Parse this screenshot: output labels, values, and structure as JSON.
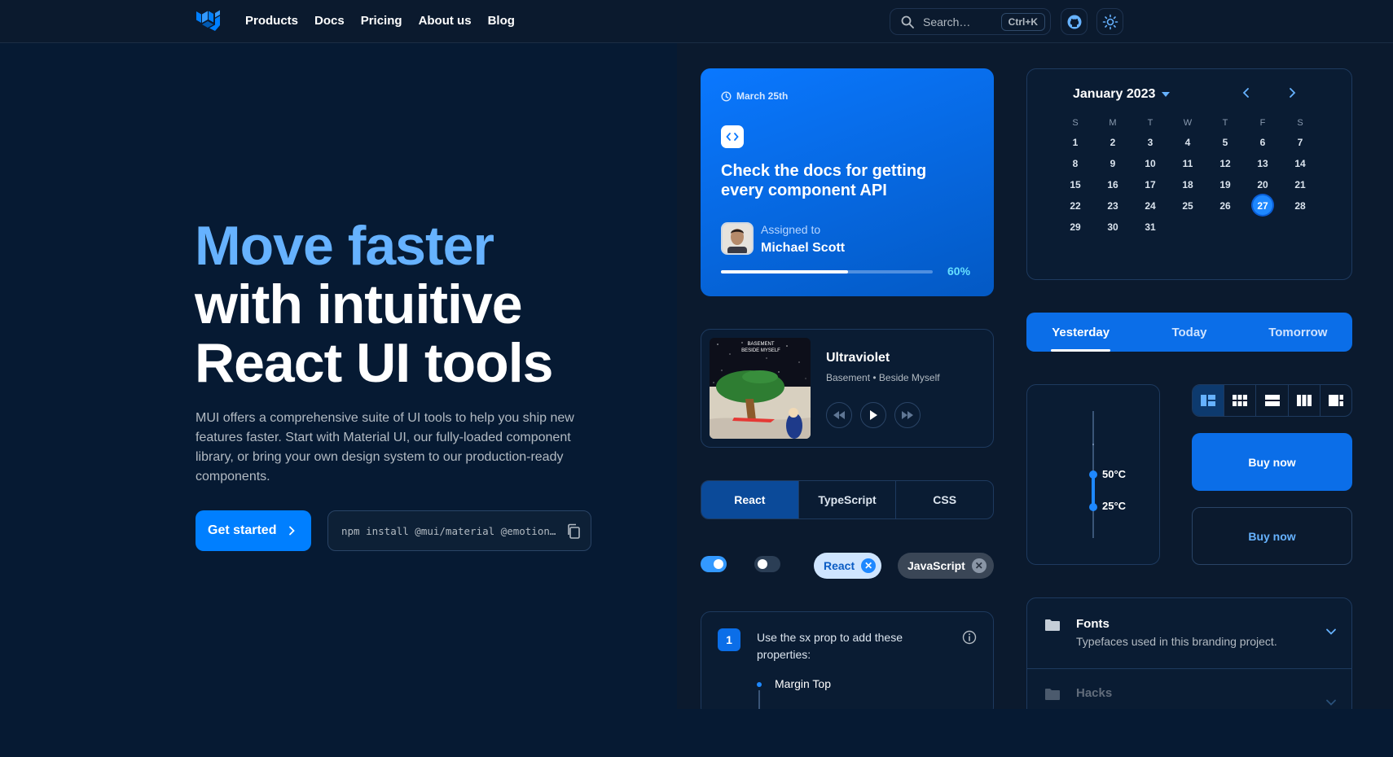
{
  "header": {
    "nav": [
      "Products",
      "Docs",
      "Pricing",
      "About us",
      "Blog"
    ],
    "search_placeholder": "Search…",
    "search_shortcut": "Ctrl+K"
  },
  "hero": {
    "title_accent": "Move faster",
    "title_line2": "with intuitive",
    "title_line3": "React UI tools",
    "description": "MUI offers a comprehensive suite of UI tools to help you ship new features faster. Start with Material UI, our fully-loaded component library, or bring your own design system to our production-ready components.",
    "cta_label": "Get started",
    "install_cmd": "npm install @mui/material @emotion…"
  },
  "task_card": {
    "date": "March 25th",
    "title": "Check the docs for getting every component API",
    "assigned_label": "Assigned to",
    "assignee": "Michael Scott",
    "progress_text": "60%",
    "progress": 0.6
  },
  "calendar": {
    "month": "January 2023",
    "weekdays": [
      "S",
      "M",
      "T",
      "W",
      "T",
      "F",
      "S"
    ],
    "days": [
      1,
      2,
      3,
      4,
      5,
      6,
      7,
      8,
      9,
      10,
      11,
      12,
      13,
      14,
      15,
      16,
      17,
      18,
      19,
      20,
      21,
      22,
      23,
      24,
      25,
      26,
      27,
      28,
      29,
      30,
      31
    ],
    "selected": 27
  },
  "music": {
    "song": "Ultraviolet",
    "artist": "Basement • Beside Myself",
    "cover_text": "BASEMENT BESIDE MYSELF"
  },
  "day_tabs": [
    "Yesterday",
    "Today",
    "Tomorrow"
  ],
  "lang_toggle": [
    "React",
    "TypeScript",
    "CSS"
  ],
  "chips": [
    "React",
    "JavaScript"
  ],
  "slider": {
    "high": "50°C",
    "low": "25°C"
  },
  "buttons": {
    "buy_contained": "Buy now",
    "buy_outlined": "Buy now"
  },
  "stepper": {
    "step": "1",
    "text": "Use the sx prop to add these properties:",
    "item": "Margin Top"
  },
  "accordion": [
    {
      "title": "Fonts",
      "subtitle": "Typefaces used in this branding project."
    },
    {
      "title": "Hacks",
      "subtitle": ""
    }
  ],
  "colors": {
    "accent": "#66b2ff",
    "primary": "#007fff",
    "background": "#061a33"
  }
}
